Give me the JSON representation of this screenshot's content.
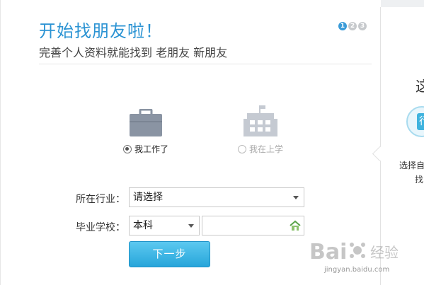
{
  "header": {
    "title": "开始找朋友啦！",
    "subtitle": "完善个人资料就能找到 老朋友 新朋友",
    "steps": [
      "1",
      "2",
      "3"
    ],
    "active_step": 1
  },
  "status_options": {
    "work": {
      "label": "我工作了",
      "selected": true
    },
    "school": {
      "label": "我在上学",
      "selected": false
    }
  },
  "form": {
    "industry_label": "所在行业：",
    "industry_value": "请选择",
    "school_label": "毕业学校：",
    "degree_value": "本科",
    "school_input_value": "",
    "next_label": "下一步"
  },
  "side_panel": {
    "char": "这",
    "circle_char": "行",
    "text_line1": "选择自",
    "text_line2": "找"
  },
  "watermark": {
    "brand": "Baidu经验",
    "url": "jingyan.baidu.com"
  },
  "colors": {
    "accent": "#2b93d3",
    "button": "#27a5da",
    "icon_gray": "#8a94a3"
  }
}
